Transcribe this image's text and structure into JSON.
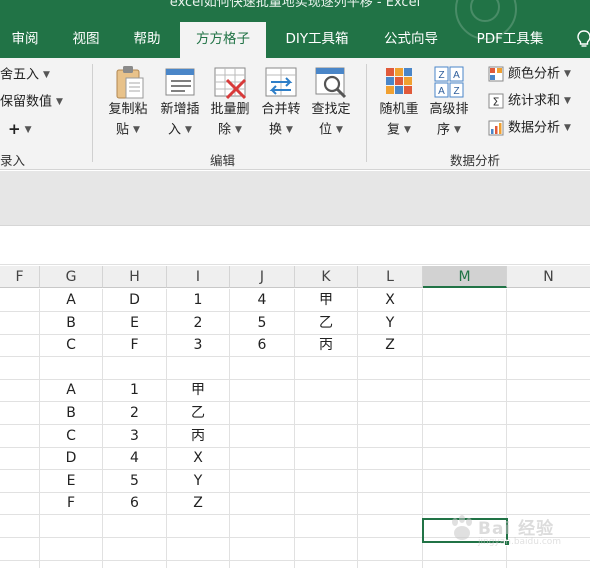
{
  "window": {
    "title": "excel如何快速批量地实现逐列平移 - Excel"
  },
  "tabs": [
    {
      "label": "审阅",
      "active": false
    },
    {
      "label": "视图",
      "active": false
    },
    {
      "label": "帮助",
      "active": false
    },
    {
      "label": "方方格子",
      "active": true
    },
    {
      "label": "DIY工具箱",
      "active": false
    },
    {
      "label": "公式向导",
      "active": false
    },
    {
      "label": "PDF工具集",
      "active": false
    }
  ],
  "ribbon": {
    "left_items": [
      "舍五入",
      "保留数值",
      "+",
      "录入"
    ],
    "edit_buttons": [
      {
        "line1": "复制粘",
        "line2": "贴"
      },
      {
        "line1": "新增插",
        "line2": "入"
      },
      {
        "line1": "批量删",
        "line2": "除"
      },
      {
        "line1": "合并转",
        "line2": "换"
      },
      {
        "line1": "查找定",
        "line2": "位"
      }
    ],
    "edit_group_label": "编辑",
    "analysis_buttons": [
      {
        "line1": "随机重",
        "line2": "复"
      },
      {
        "line1": "高级排",
        "line2": "序"
      }
    ],
    "analysis_small": [
      "颜色分析",
      "统计求和",
      "数据分析"
    ],
    "analysis_group_label": "数据分析"
  },
  "grid": {
    "columns": [
      "F",
      "G",
      "H",
      "I",
      "J",
      "K",
      "L",
      "M",
      "N"
    ],
    "selected_column": "M",
    "rows": [
      [
        "",
        "A",
        "D",
        "1",
        "4",
        "甲",
        "X",
        "",
        ""
      ],
      [
        "",
        "B",
        "E",
        "2",
        "5",
        "乙",
        "Y",
        "",
        ""
      ],
      [
        "",
        "C",
        "F",
        "3",
        "6",
        "丙",
        "Z",
        "",
        ""
      ],
      [
        "",
        "",
        "",
        "",
        "",
        "",
        "",
        "",
        ""
      ],
      [
        "",
        "A",
        "1",
        "甲",
        "",
        "",
        "",
        "",
        ""
      ],
      [
        "",
        "B",
        "2",
        "乙",
        "",
        "",
        "",
        "",
        ""
      ],
      [
        "",
        "C",
        "3",
        "丙",
        "",
        "",
        "",
        "",
        ""
      ],
      [
        "",
        "D",
        "4",
        "X",
        "",
        "",
        "",
        "",
        ""
      ],
      [
        "",
        "E",
        "5",
        "Y",
        "",
        "",
        "",
        "",
        ""
      ],
      [
        "",
        "F",
        "6",
        "Z",
        "",
        "",
        "",
        "",
        ""
      ],
      [
        "",
        "",
        "",
        "",
        "",
        "",
        "",
        "",
        ""
      ],
      [
        "",
        "",
        "",
        "",
        "",
        "",
        "",
        "",
        ""
      ],
      [
        "",
        "",
        "",
        "",
        "",
        "",
        "",
        "",
        ""
      ]
    ]
  },
  "watermark": {
    "text": "Bai 经验",
    "sub": "jingyan.baidu.com"
  },
  "colors": {
    "accent": "#217346",
    "ribbon_bg": "#f3f3f3"
  }
}
